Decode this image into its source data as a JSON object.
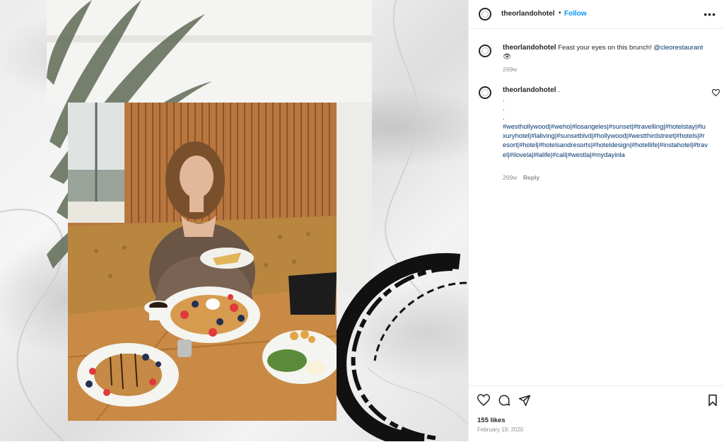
{
  "post": {
    "username": "theorlandohotel",
    "follow_label": "Follow",
    "separator": "•",
    "more_icon": "more-options-icon",
    "caption": {
      "username": "theorlandohotel",
      "text": "Feast your eyes on this brunch!",
      "mention": "@cleorestaurant",
      "emoji": "👁",
      "time": "269w"
    },
    "comment": {
      "username": "theorlandohotel",
      "text": ".",
      "dots": [
        ".",
        ".",
        "."
      ],
      "hashtags": "#westhollywood|#weho|#losangeles|#sunset|#travelling|#hotelstay|#luxuryhotel|#laliving|#sunsetblvd|#hollywood|#westthirdstreet|#hotels|#resort|#hotel|#hotelsandresorts|#hoteldesign|#hotellife|#instahotel|#travel|#ilovela|#lalife|#cali|#westla|#mydayinla",
      "time": "269w",
      "reply_label": "Reply"
    },
    "likes": "155 likes",
    "date": "February 19, 2020"
  },
  "colors": {
    "link": "#0095f6",
    "hashtag": "#00376b",
    "text": "#262626",
    "muted": "#8e8e8e"
  }
}
